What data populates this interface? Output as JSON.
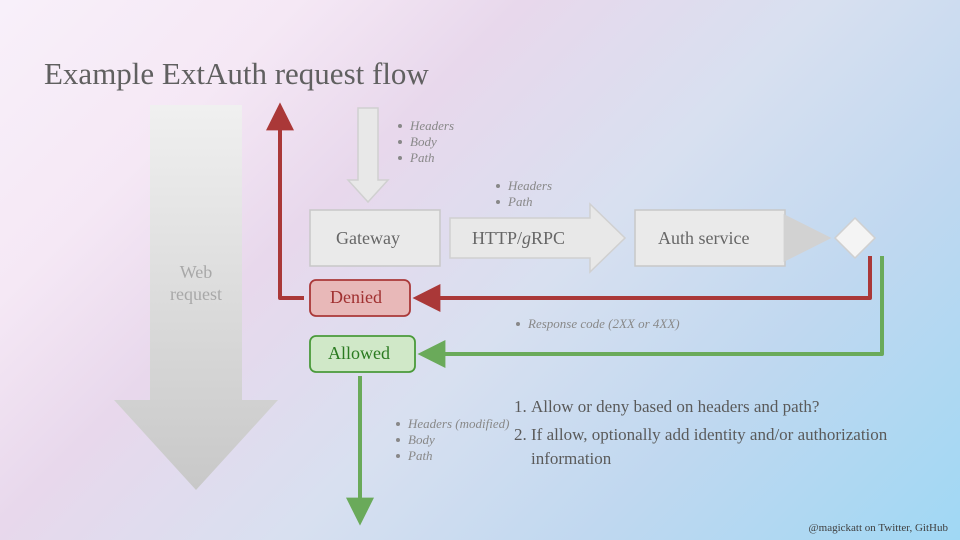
{
  "title": "Example ExtAuth request flow",
  "footer": "@magickatt on Twitter, GitHub",
  "web_request": {
    "line1": "Web",
    "line2": "request"
  },
  "gateway_label": "Gateway",
  "protocol_label": "HTTP/gRPC",
  "auth_service_label": "Auth service",
  "denied_label": "Denied",
  "allowed_label": "Allowed",
  "bullets_gateway": [
    "Headers",
    "Body",
    "Path"
  ],
  "bullets_protocol": [
    "Headers",
    "Path"
  ],
  "bullets_modified": [
    "Headers (modified)",
    "Body",
    "Path"
  ],
  "response_code_note": "Response code (2XX or 4XX)",
  "numbered": [
    "Allow or deny based on headers and path?",
    "If allow, optionally add identity and/or authorization information"
  ]
}
